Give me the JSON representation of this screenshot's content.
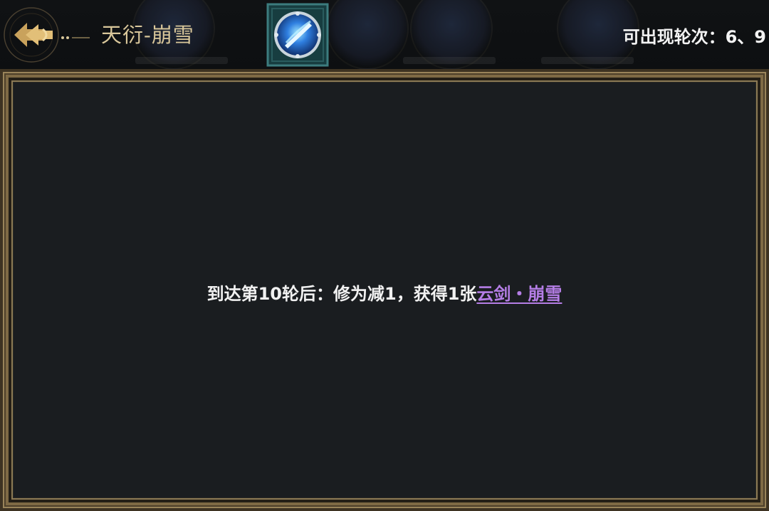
{
  "header": {
    "title": "天衍-崩雪",
    "rounds_label": "可出现轮次：",
    "rounds_values": "6、9",
    "back_icon": "back-arrow-icon",
    "skill_icon": "ice-sword-skill-icon"
  },
  "panel": {
    "description_prefix": "到达第10轮后：修为减1，获得1张",
    "card_link": "云剑・崩雪"
  },
  "colors": {
    "title_gold": "#d9c79a",
    "link_purple": "#b57ee6",
    "panel_bg": "#1a1d20",
    "frame_gold": "#8c7a55"
  }
}
